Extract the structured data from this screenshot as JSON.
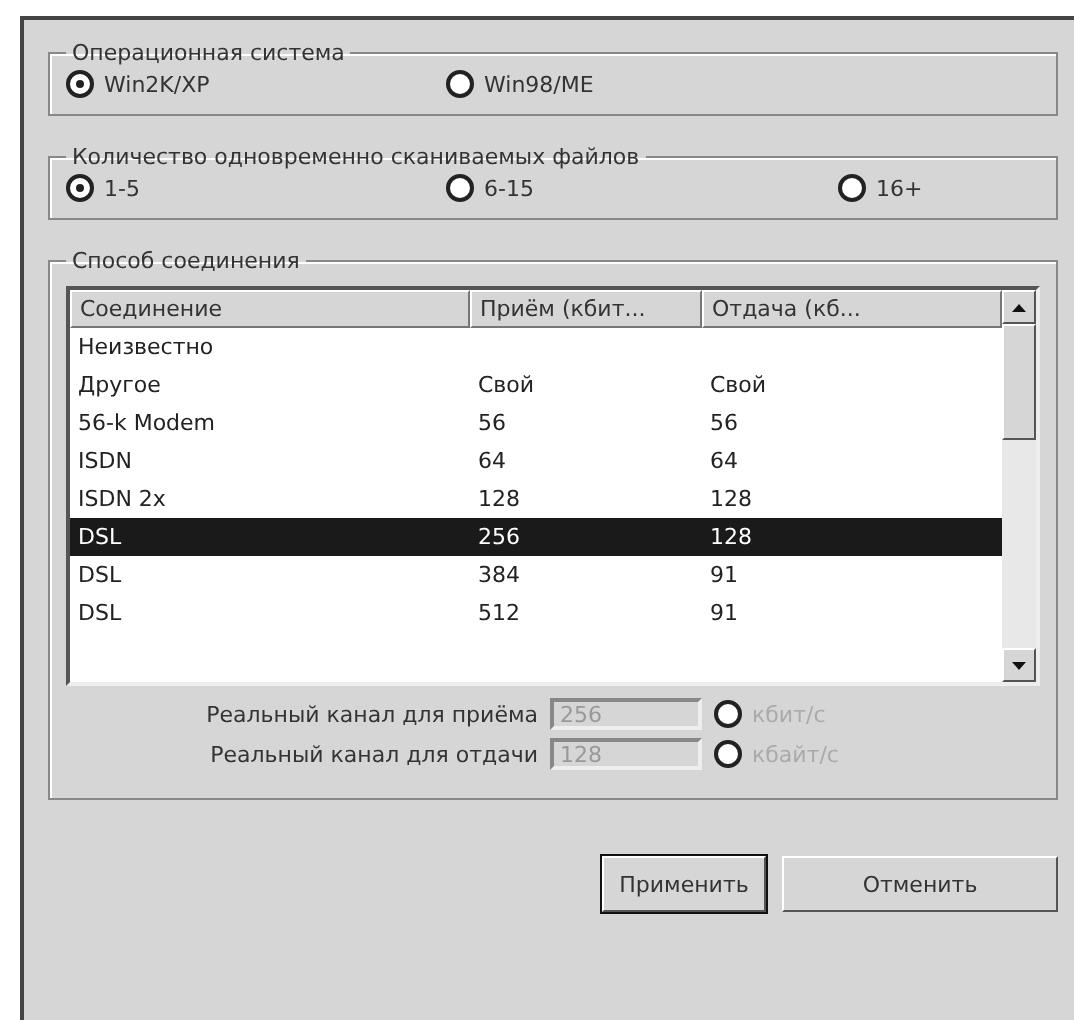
{
  "os_group": {
    "title": "Операционная система",
    "options": [
      {
        "label": "Win2K/XP",
        "selected": true
      },
      {
        "label": "Win98/ME",
        "selected": false
      }
    ]
  },
  "files_group": {
    "title": "Количество одновременно сканиваемых файлов",
    "options": [
      {
        "label": "1-5",
        "selected": true
      },
      {
        "label": "6-15",
        "selected": false
      },
      {
        "label": "16+",
        "selected": false
      }
    ]
  },
  "connection_group": {
    "title": "Способ соединения",
    "table": {
      "columns": [
        "Соединение",
        "Приём (кбит...",
        "Отдача (кб..."
      ],
      "rows": [
        {
          "cells": [
            "Неизвестно",
            "",
            ""
          ],
          "selected": false
        },
        {
          "cells": [
            "Другое",
            "Свой",
            "Свой"
          ],
          "selected": false
        },
        {
          "cells": [
            "56-k Modem",
            "56",
            "56"
          ],
          "selected": false
        },
        {
          "cells": [
            "ISDN",
            "64",
            "64"
          ],
          "selected": false
        },
        {
          "cells": [
            "ISDN 2x",
            "128",
            "128"
          ],
          "selected": false
        },
        {
          "cells": [
            "DSL",
            "256",
            "128"
          ],
          "selected": true
        },
        {
          "cells": [
            "DSL",
            "384",
            "91"
          ],
          "selected": false
        },
        {
          "cells": [
            "DSL",
            "512",
            "91"
          ],
          "selected": false
        }
      ]
    },
    "fields": [
      {
        "label": "Реальный канал для приёма",
        "value": "256",
        "disabled": true,
        "unit": "кбит/с",
        "unit_selected": false
      },
      {
        "label": "Реальный канал для отдачи",
        "value": "128",
        "disabled": true,
        "unit": "кбайт/с",
        "unit_selected": false
      }
    ]
  },
  "buttons": [
    {
      "label": "Применить",
      "default": true
    },
    {
      "label": "Отменить",
      "default": false
    }
  ]
}
